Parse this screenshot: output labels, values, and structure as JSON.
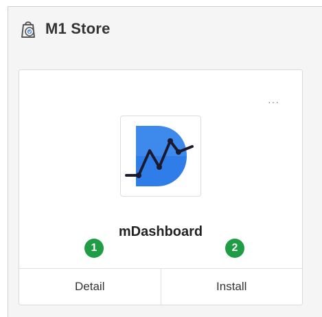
{
  "header": {
    "title": "M1 Store",
    "icon": "store-bag-icon"
  },
  "card": {
    "app_name": "mDashboard",
    "more_label": "···",
    "app_icon": "mdashboard-logo",
    "actions": {
      "detail_label": "Detail",
      "install_label": "Install"
    }
  },
  "annotations": {
    "badge_1": "1",
    "badge_2": "2"
  },
  "colors": {
    "badge_green": "#1f9d45",
    "logo_blue": "#2f7de8",
    "logo_line": "#1a1a2e"
  }
}
